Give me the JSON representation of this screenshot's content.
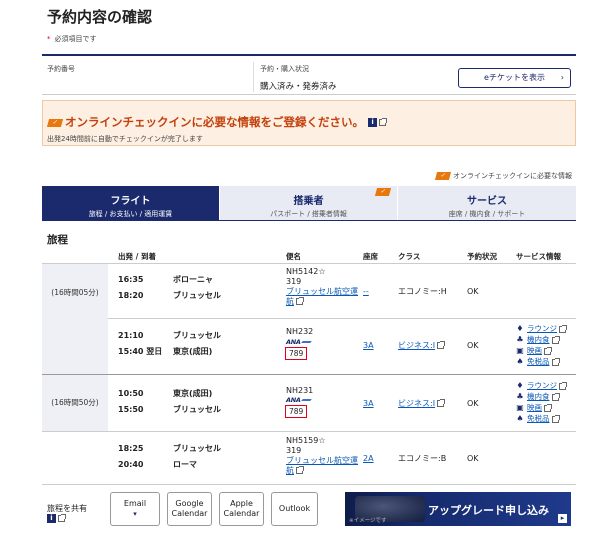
{
  "page": {
    "title": "予約内容の確認",
    "required_note": "必須項目です",
    "required_mark": "*"
  },
  "booking": {
    "reservation_number_label": "予約番号",
    "status_label": "予約・購入状況",
    "status_value": "購入済み・発券済み",
    "eticket_button": "eチケットを表示",
    "eticket_chevron": "›"
  },
  "notice": {
    "title": "オンラインチェックインに必要な情報をご登録ください。",
    "sub": "出発24時間前に自動でチェックインが完了します",
    "info_icon": "i"
  },
  "ci_legend": "オンラインチェックインに必要な情報",
  "tabs": [
    {
      "label": "フライト",
      "sub": "旅程 / お支払い / 適用運賃"
    },
    {
      "label": "搭乗者",
      "sub": "パスポート / 搭乗者情報"
    },
    {
      "label": "サービス",
      "sub": "座席 / 機内食 / サポート"
    }
  ],
  "itinerary": {
    "title": "旅程",
    "headers": {
      "dep_arr": "出発 / 到着",
      "flight": "便名",
      "seat": "座席",
      "class": "クラス",
      "status": "予約状況",
      "services": "サービス情報"
    },
    "journeys": [
      {
        "duration": "(16時間05分)",
        "segments": [
          {
            "dep_time": "16:35",
            "arr_time": "18:20",
            "dep_city": "ボローニャ",
            "arr_city": "ブリュッセル",
            "flight_no": "NH5142☆",
            "flight_sub": "319",
            "operator_link": "ブリュッセル航空運航",
            "seat": "--",
            "class": "エコノミー:H",
            "status": "OK"
          },
          {
            "dep_time": "21:10",
            "arr_time": "15:40 翌日",
            "dep_city": "ブリュッセル",
            "arr_city": "東京(成田)",
            "flight_no": "NH232",
            "airline_logo": "ANA",
            "aircraft": "789",
            "seat": "3A",
            "class": "ビジネス:I",
            "status": "OK"
          }
        ]
      },
      {
        "duration": "(16時間50分)",
        "segments": [
          {
            "dep_time": "10:50",
            "arr_time": "15:50",
            "dep_city": "東京(成田)",
            "arr_city": "ブリュッセル",
            "flight_no": "NH231",
            "airline_logo": "ANA",
            "aircraft": "789",
            "seat": "3A",
            "class": "ビジネス:I",
            "status": "OK"
          },
          {
            "dep_time": "18:25",
            "arr_time": "20:40",
            "dep_city": "ブリュッセル",
            "arr_city": "ローマ",
            "flight_no": "NH5159☆",
            "flight_sub": "319",
            "operator_link": "ブリュッセル航空運航",
            "seat": "2A",
            "class": "エコノミー:B",
            "status": "OK"
          }
        ]
      }
    ],
    "service_links": [
      "ラウンジ",
      "機内食",
      "映画",
      "免税品"
    ]
  },
  "share": {
    "label": "旅程を共有",
    "buttons": [
      {
        "line1": "Email",
        "line2": "▾"
      },
      {
        "line1": "Google",
        "line2": "Calendar"
      },
      {
        "line1": "Apple",
        "line2": "Calendar"
      },
      {
        "line1": "Outlook",
        "line2": ""
      }
    ]
  },
  "upgrade": {
    "label": "アップグレード申し込み",
    "caption": "※イメージです",
    "arrow": "▸"
  },
  "colors": {
    "navy": "#1a2a6c",
    "notice_bg": "#fdefe2",
    "notice_text": "#c3410d",
    "highlight_box": "#e0001a",
    "link": "#0a58b5"
  }
}
